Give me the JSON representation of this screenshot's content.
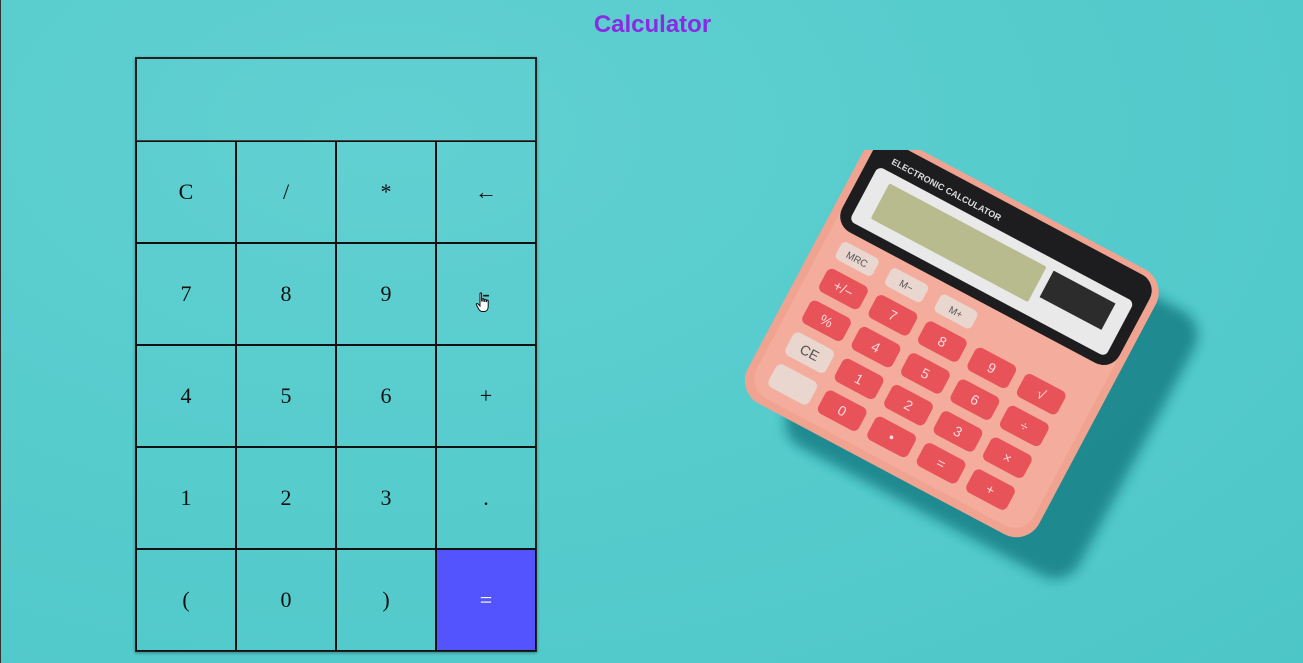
{
  "title": "Calculator",
  "display": {
    "value": ""
  },
  "keys": [
    {
      "label": "C",
      "name": "clear-button"
    },
    {
      "label": "/",
      "name": "divide-button"
    },
    {
      "label": "*",
      "name": "multiply-button"
    },
    {
      "label": "←",
      "name": "backspace-button"
    },
    {
      "label": "7",
      "name": "digit-7-button"
    },
    {
      "label": "8",
      "name": "digit-8-button"
    },
    {
      "label": "9",
      "name": "digit-9-button"
    },
    {
      "label": "-",
      "name": "subtract-button"
    },
    {
      "label": "4",
      "name": "digit-4-button"
    },
    {
      "label": "5",
      "name": "digit-5-button"
    },
    {
      "label": "6",
      "name": "digit-6-button"
    },
    {
      "label": "+",
      "name": "add-button"
    },
    {
      "label": "1",
      "name": "digit-1-button"
    },
    {
      "label": "2",
      "name": "digit-2-button"
    },
    {
      "label": "3",
      "name": "digit-3-button"
    },
    {
      "label": ".",
      "name": "decimal-button"
    },
    {
      "label": "(",
      "name": "open-paren-button"
    },
    {
      "label": "0",
      "name": "digit-0-button"
    },
    {
      "label": ")",
      "name": "close-paren-button"
    },
    {
      "label": "=",
      "name": "equals-button"
    }
  ],
  "photo": {
    "brand_text": "ELECTRONIC CALCULATOR",
    "keys": [
      "MRC",
      "M−",
      "M+",
      "+/−",
      "7",
      "8",
      "9",
      "√",
      "÷",
      "%",
      "4",
      "5",
      "6",
      "×",
      "CE",
      "1",
      "2",
      "3",
      "−",
      "0",
      "•",
      "=",
      "+"
    ]
  },
  "colors": {
    "background": "#57cccd",
    "title": "#8a2be2",
    "equals_bg": "#5454ff",
    "calculator_body": "#f29a8a",
    "calculator_keys": "#ea4f56"
  },
  "icons": {
    "cursor": "hand-pointer-icon"
  }
}
